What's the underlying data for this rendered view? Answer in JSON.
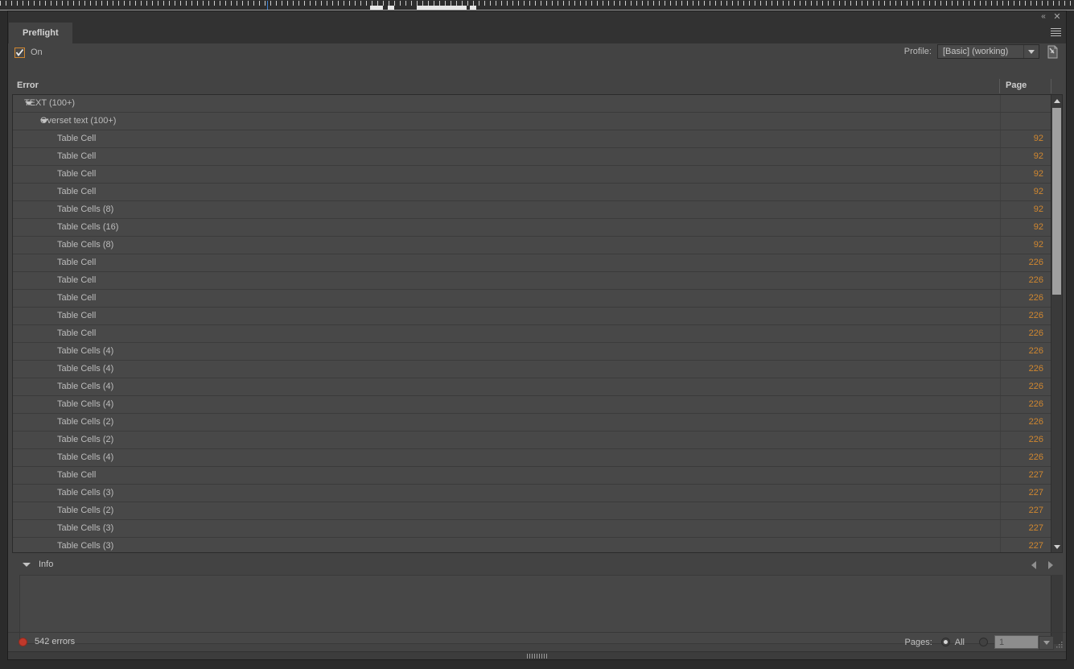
{
  "window": {
    "collapse_icon": "collapse-left-icon",
    "close_icon": "close-icon",
    "collapse_glyph": "«",
    "close_glyph": "✕"
  },
  "tab": {
    "label": "Preflight",
    "menu_icon": "panel-menu-icon"
  },
  "controls": {
    "on_label": "On",
    "on_checked": true,
    "profile_label": "Profile:",
    "profile_value": "[Basic] (working)",
    "profile_embed_icon": "embed-profile-icon"
  },
  "columns": {
    "error": "Error",
    "page": "Page"
  },
  "list": {
    "rows": [
      {
        "type": "group",
        "label": "TEXT (100+)",
        "page": "",
        "expanded": true
      },
      {
        "type": "subgroup",
        "label": "Overset text (100+)",
        "page": "",
        "expanded": true
      },
      {
        "type": "item",
        "label": "Table Cell",
        "page": "92"
      },
      {
        "type": "item",
        "label": "Table Cell",
        "page": "92"
      },
      {
        "type": "item",
        "label": "Table Cell",
        "page": "92"
      },
      {
        "type": "item",
        "label": "Table Cell",
        "page": "92"
      },
      {
        "type": "item",
        "label": "Table Cells (8)",
        "page": "92"
      },
      {
        "type": "item",
        "label": "Table Cells (16)",
        "page": "92"
      },
      {
        "type": "item",
        "label": "Table Cells (8)",
        "page": "92"
      },
      {
        "type": "item",
        "label": "Table Cell",
        "page": "226"
      },
      {
        "type": "item",
        "label": "Table Cell",
        "page": "226"
      },
      {
        "type": "item",
        "label": "Table Cell",
        "page": "226"
      },
      {
        "type": "item",
        "label": "Table Cell",
        "page": "226"
      },
      {
        "type": "item",
        "label": "Table Cell",
        "page": "226"
      },
      {
        "type": "item",
        "label": "Table Cells (4)",
        "page": "226"
      },
      {
        "type": "item",
        "label": "Table Cells (4)",
        "page": "226"
      },
      {
        "type": "item",
        "label": "Table Cells (4)",
        "page": "226"
      },
      {
        "type": "item",
        "label": "Table Cells (4)",
        "page": "226"
      },
      {
        "type": "item",
        "label": "Table Cells (2)",
        "page": "226"
      },
      {
        "type": "item",
        "label": "Table Cells (2)",
        "page": "226"
      },
      {
        "type": "item",
        "label": "Table Cells (4)",
        "page": "226"
      },
      {
        "type": "item",
        "label": "Table Cell",
        "page": "227"
      },
      {
        "type": "item",
        "label": "Table Cells (3)",
        "page": "227"
      },
      {
        "type": "item",
        "label": "Table Cells (2)",
        "page": "227"
      },
      {
        "type": "item",
        "label": "Table Cells (3)",
        "page": "227"
      },
      {
        "type": "item",
        "label": "Table Cells (3)",
        "page": "227"
      }
    ]
  },
  "info": {
    "label": "Info",
    "expanded": true,
    "prev_icon": "arrow-left-icon",
    "next_icon": "arrow-right-icon",
    "content": ""
  },
  "status": {
    "error_count": "542 errors",
    "error_dot_color": "#c0392b",
    "pages_label": "Pages:",
    "pages_all_label": "All",
    "pages_all_selected": true,
    "pages_range_selected": false,
    "pages_range_value": "1"
  },
  "colors": {
    "accent_orange": "#d08730",
    "panel_bg": "#434343",
    "list_bg": "#484848",
    "text": "#bcbcbc"
  }
}
